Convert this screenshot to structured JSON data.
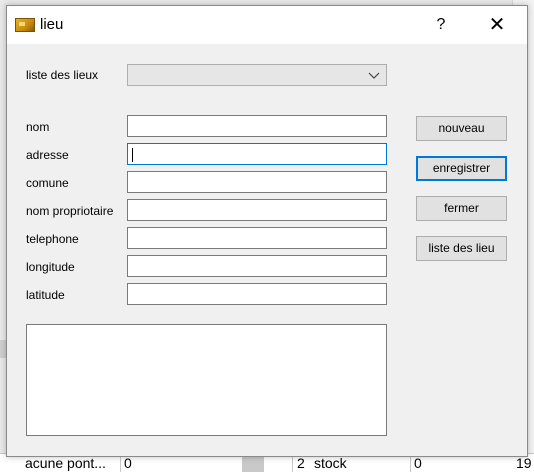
{
  "dialog": {
    "title": "lieu",
    "help_label": "?",
    "close_label": "✕"
  },
  "form": {
    "list_label": "liste des lieux",
    "list_selected": "",
    "fields": [
      {
        "label": "nom",
        "value": ""
      },
      {
        "label": "adresse",
        "value": ""
      },
      {
        "label": "comune",
        "value": ""
      },
      {
        "label": "nom propriotaire",
        "value": ""
      },
      {
        "label": "telephone",
        "value": ""
      },
      {
        "label": "longitude",
        "value": ""
      },
      {
        "label": "latitude",
        "value": ""
      }
    ],
    "notes_value": ""
  },
  "buttons": {
    "new_label": "nouveau",
    "save_label": "enregistrer",
    "close_label": "fermer",
    "list_label": "liste des lieu"
  },
  "background": {
    "right_fragment_1": "d",
    "right_fragment_2": "l",
    "right_fragment_3": "e",
    "cells": [
      "acune pont...",
      "0",
      "2",
      "stock",
      "0",
      "19"
    ]
  },
  "colors": {
    "focus": "#0078d7",
    "window_bg": "#f0f0f0",
    "title_bar": "#ffffff"
  }
}
